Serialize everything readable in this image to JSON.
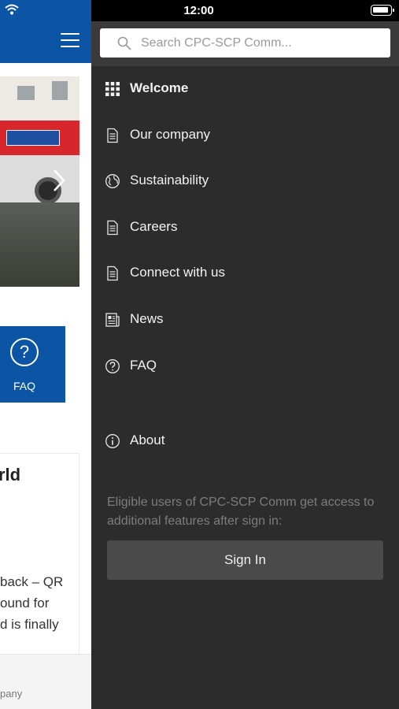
{
  "status_bar": {
    "time": "12:00"
  },
  "background": {
    "faq_label": "FAQ",
    "faq_glyph": "?",
    "card_title": "rld",
    "card_lines": [
      "back – QR",
      "ound for",
      "d is finally"
    ],
    "footer_text": "pany"
  },
  "search": {
    "placeholder": "Search CPC-SCP Comm...",
    "value": ""
  },
  "menu": {
    "items": [
      {
        "label": "Welcome",
        "icon": "grid-icon",
        "active": true
      },
      {
        "label": "Our company",
        "icon": "document-icon"
      },
      {
        "label": "Sustainability",
        "icon": "globe-icon"
      },
      {
        "label": "Careers",
        "icon": "document-icon"
      },
      {
        "label": "Connect with us",
        "icon": "document-icon"
      },
      {
        "label": "News",
        "icon": "newspaper-icon"
      },
      {
        "label": "FAQ",
        "icon": "question-circle-icon"
      },
      {
        "label": "About",
        "icon": "info-circle-icon"
      }
    ]
  },
  "signin": {
    "note": "Eligible users of CPC-SCP Comm get access to additional features after sign in:",
    "button_label": "Sign In"
  },
  "colors": {
    "brand_blue": "#0b55a4",
    "drawer_bg": "#2c2c2c",
    "search_bar_bg": "#3a3a3a",
    "button_bg": "#4a4a4a"
  }
}
